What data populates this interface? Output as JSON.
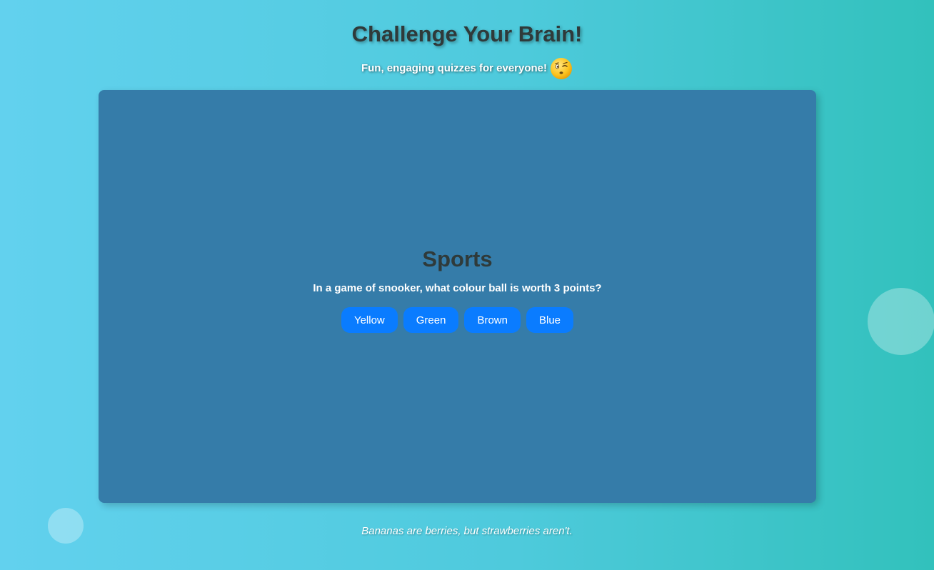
{
  "header": {
    "title": "Challenge Your Brain!",
    "subtitle": "Fun, engaging quizzes for everyone!",
    "subtitle_icon": "winking-face-icon"
  },
  "quiz": {
    "category": "Sports",
    "question": "In a game of snooker, what colour ball is worth 3 points?",
    "answers": [
      "Yellow",
      "Green",
      "Brown",
      "Blue"
    ]
  },
  "footer": {
    "fact": "Bananas are berries, but strawberries aren't."
  },
  "colors": {
    "card_background": "#357ca9",
    "answer_button": "#0a7cff",
    "gradient_start": "#62d1ee",
    "gradient_end": "#32c1bc"
  }
}
